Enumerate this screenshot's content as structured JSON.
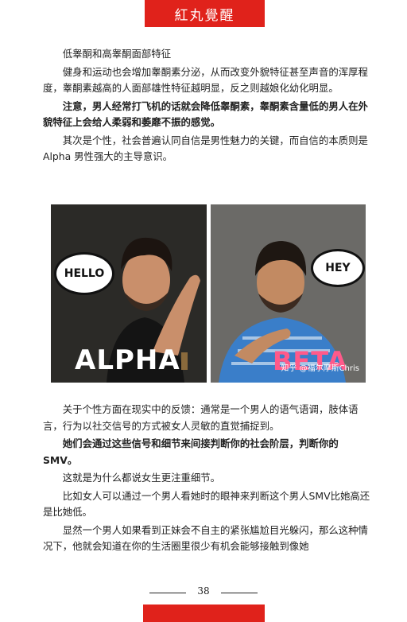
{
  "header": {
    "title": "紅丸覺醒"
  },
  "paragraphs_top": [
    {
      "text": "低睾酮和高睾酮面部特征",
      "bold": false
    },
    {
      "text": "健身和运动也会增加睾酮素分泌，从而改变外貌特征甚至声音的浑厚程度，睾酮素越高的人面部雄性特征越明显，反之则越娘化幼化明显。",
      "bold": false
    },
    {
      "text": "注意，男人经常打飞机的话就会降低睾酮素，睾酮素含量低的男人在外貌特征上会给人柔弱和萎靡不振的感觉。",
      "bold": true
    },
    {
      "text": "其次是个性，社会普遍认同自信是男性魅力的关键，而自信的本质则是Alpha 男性强大的主导意识。",
      "bold": false
    }
  ],
  "image": {
    "left_bubble": "HELLO",
    "right_bubble": "HEY",
    "left_label": "ALPHA",
    "right_label": "BETA",
    "watermark": "知乎 @福尔摩斯Chris",
    "colors": {
      "alpha_bg": "#2b2a27",
      "beta_bg": "#6b6a67",
      "beta_label": "#ff5a8a"
    }
  },
  "paragraphs_bottom": [
    {
      "text": "关于个性方面在现实中的反馈：通常是一个男人的语气语调，肢体语言，行为以社交信号的方式被女人灵敏的直觉捕捉到。",
      "bold": false
    },
    {
      "text": "她们会通过这些信号和细节来间接判断你的社会阶层，判断你的SMV。",
      "bold": true
    },
    {
      "text": "这就是为什么都说女生更注重细节。",
      "bold": false
    },
    {
      "text": "比如女人可以通过一个男人看她时的眼神来判断这个男人SMV比她高还是比她低。",
      "bold": false
    },
    {
      "text": "显然一个男人如果看到正妹会不自主的紧张尴尬目光躲闪，那么这种情况下，他就会知道在你的生活圈里很少有机会能够接触到像她",
      "bold": false
    }
  ],
  "footer": {
    "page_number": "38"
  }
}
